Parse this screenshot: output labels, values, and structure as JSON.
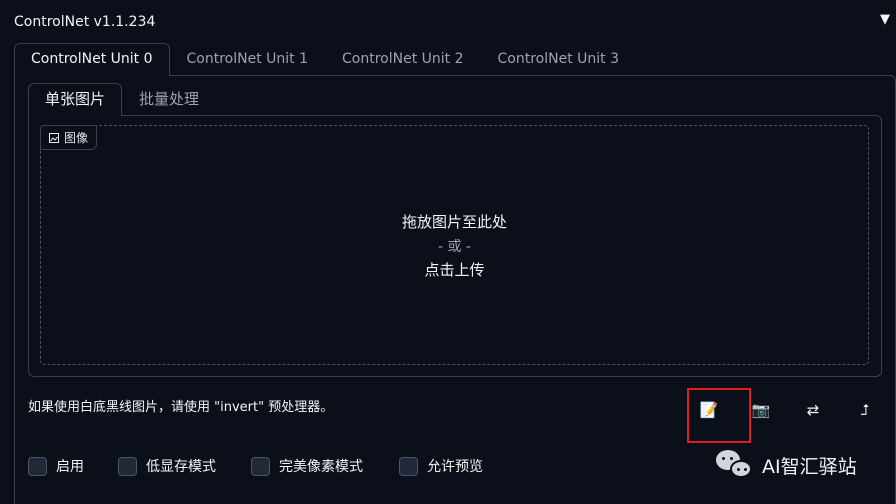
{
  "panel": {
    "title": "ControlNet v1.1.234",
    "collapse_icon": "▼"
  },
  "unit_tabs": [
    {
      "label": "ControlNet Unit 0",
      "active": true
    },
    {
      "label": "ControlNet Unit 1",
      "active": false
    },
    {
      "label": "ControlNet Unit 2",
      "active": false
    },
    {
      "label": "ControlNet Unit 3",
      "active": false
    }
  ],
  "image_tabs": [
    {
      "label": "单张图片",
      "active": true
    },
    {
      "label": "批量处理",
      "active": false
    }
  ],
  "image_input": {
    "label": "图像",
    "drop_text": "拖放图片至此处",
    "or_text": "- 或 -",
    "upload_text": "点击上传"
  },
  "hint_text": "如果使用白底黑线图片，请使用 \"invert\" 预处理器。",
  "tools": [
    {
      "icon": "notepad-icon",
      "glyph": "📝"
    },
    {
      "icon": "camera-icon",
      "glyph": "📷"
    },
    {
      "icon": "swap-arrows-icon",
      "glyph": "⇄"
    },
    {
      "icon": "send-arrow-icon",
      "glyph": "⮥"
    }
  ],
  "options": [
    {
      "label": "启用",
      "checked": false
    },
    {
      "label": "低显存模式",
      "checked": false
    },
    {
      "label": "完美像素模式",
      "checked": false
    },
    {
      "label": "允许预览",
      "checked": false
    }
  ],
  "watermark": {
    "text": "AI智汇驿站"
  },
  "colors": {
    "background": "#0b0f19",
    "border": "#374151",
    "highlight": "#e11d1d",
    "text": "#f3f4f6",
    "muted": "#9ca3af"
  }
}
